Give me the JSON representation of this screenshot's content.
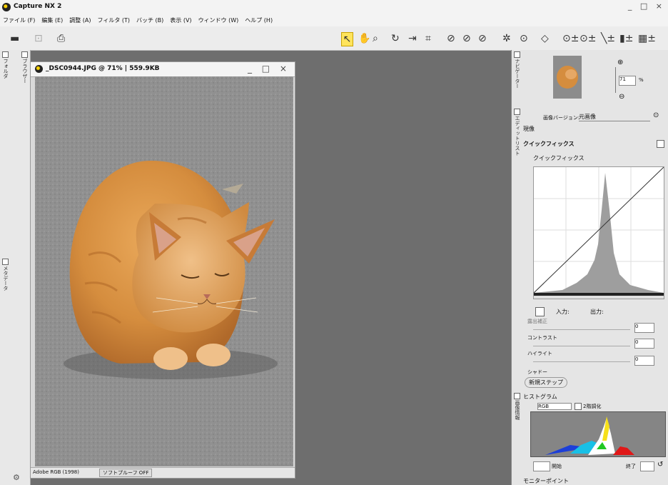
{
  "window": {
    "title": "Capture NX 2",
    "controls": "_ □ ×"
  },
  "menu": [
    "ファイル (F)",
    "編集 (E)",
    "調整 (A)",
    "フィルタ (T)",
    "バッチ (B)",
    "表示 (V)",
    "ウィンドウ (W)",
    "ヘルプ (H)"
  ],
  "left_tabs": {
    "browser": "ブラウザー",
    "folder": "フォルダ",
    "metadata": "メタデータ"
  },
  "image_window": {
    "title": "_DSC0944.JPG @ 71% | 559.9KB",
    "controls": "_ □ ×",
    "color_profile": "Adobe RGB (1998)",
    "softproof": "ソフトプルーフ OFF"
  },
  "navigator": {
    "tab": "ナビゲーター",
    "zoom_value": "71",
    "zoom_unit": "%"
  },
  "edit_list": {
    "tab": "エディットリスト",
    "version_label": "画像バージョン:",
    "version_value": "元画像",
    "section_label": "現像",
    "quickfix_header": "クイックフィックス",
    "quickfix_item": "クイックフィックス",
    "input_label": "入力:",
    "output_label": "出力:",
    "exposure_label": "露出補正",
    "contrast_label": "コントラスト",
    "highlight_label": "ハイライト",
    "shadow_label": "シャドー",
    "exposure_value": "0",
    "contrast_value": "0",
    "highlight_value": "0",
    "new_step": "新規ステップ"
  },
  "histogram": {
    "tab": "画像情報",
    "section_label": "ヒストグラム",
    "channel": "RGB",
    "gradation_label": "2階調化",
    "start_label": "開始",
    "end_label": "終了"
  },
  "monitor_point": "モニターポイント",
  "colors": {
    "accent": "#ffe45c",
    "panel": "#e5e5e5",
    "workspace": "#6e6e6e"
  }
}
